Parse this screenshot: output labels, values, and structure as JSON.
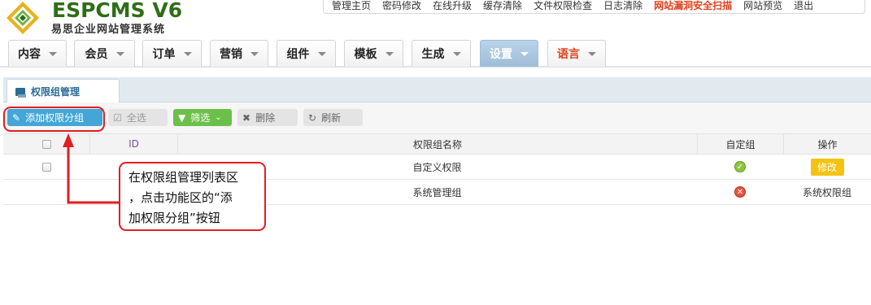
{
  "header": {
    "logo_text": "ESPCMS V6",
    "logo_subtitle": "易思企业网站管理系统",
    "top_links": [
      "管理主页",
      "密码修改",
      "在线升级",
      "缓存清除",
      "文件权限检查",
      "日志清除",
      "网站漏洞安全扫描",
      "网站预览",
      "退出"
    ],
    "alert_link": "网站漏洞安全扫描"
  },
  "menu": [
    "内容",
    "会员",
    "订单",
    "营销",
    "组件",
    "模板",
    "生成",
    "设置",
    "语言"
  ],
  "menu_active": "设置",
  "tab": {
    "label": "权限组管理"
  },
  "toolbar": {
    "add": "添加权限分组",
    "select_all": "全选",
    "filter": "筛选",
    "delete": "删除",
    "refresh": "刷新"
  },
  "table": {
    "headers": {
      "id": "ID",
      "name": "权限组名称",
      "custom": "自定组",
      "op": "操作"
    },
    "rows": [
      {
        "name": "自定义权限",
        "custom": "yes",
        "op": "修改"
      },
      {
        "name": "系统管理组",
        "custom": "no",
        "op": "系统权限组"
      }
    ]
  },
  "callout": {
    "line1": "在权限组管理列表区",
    "line2": "，点击功能区的“添",
    "line3": "加权限分组”按钮"
  },
  "colors": {
    "accent_blue": "#43a6d6",
    "filter_green": "#6cc04a",
    "edit_yellow": "#f4c311",
    "highlight_red": "#e21e22",
    "active_menu": "#a9c6df"
  },
  "icons": {
    "logo": "espcms-logo-icon",
    "tab": "window-icon",
    "add": "edit-icon",
    "select_all": "checkbox-icon",
    "filter": "funnel-icon",
    "delete": "close-icon",
    "refresh": "refresh-icon",
    "yes": "check-circle-icon",
    "no": "x-circle-icon"
  }
}
